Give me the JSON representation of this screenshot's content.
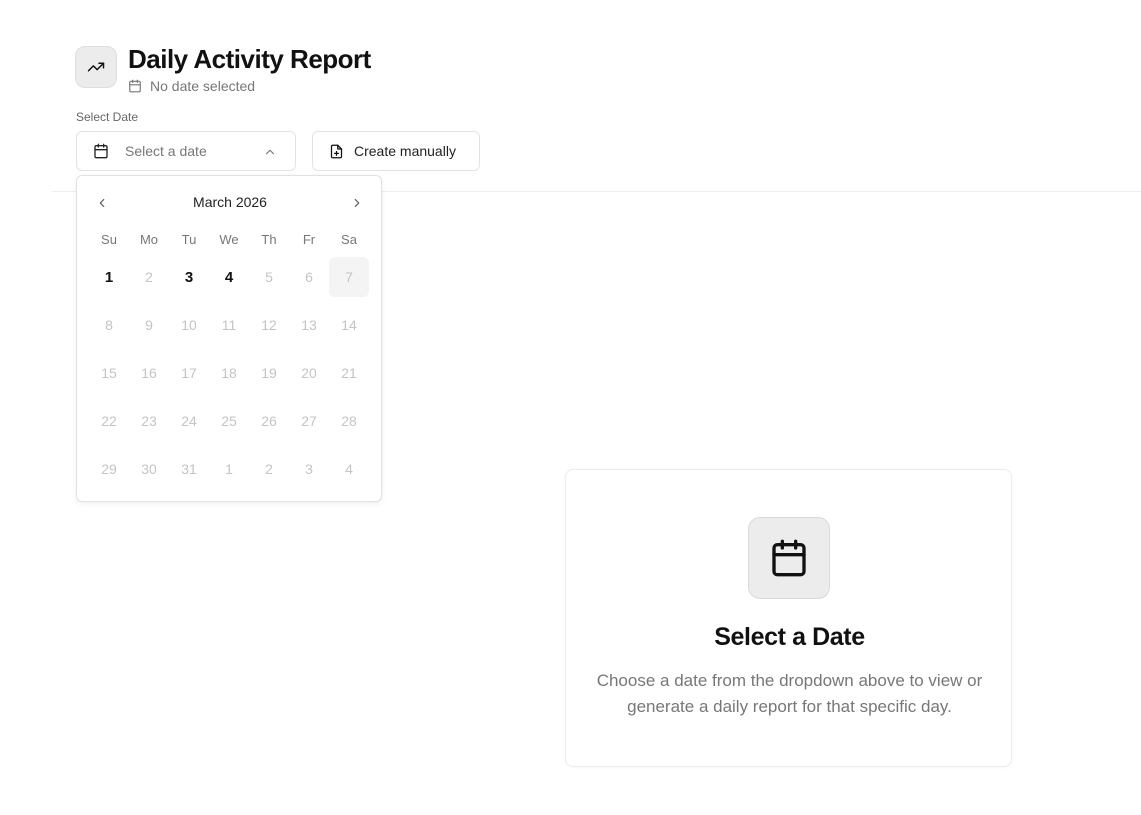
{
  "header": {
    "icon": "trending-up-icon",
    "title": "Daily Activity Report",
    "subtitle_icon": "calendar-icon",
    "subtitle": "No date selected"
  },
  "date_picker": {
    "label": "Select Date",
    "placeholder": "Select a date",
    "icon": "calendar-icon",
    "chevron_icon": "chevron-up-icon"
  },
  "manual_button": {
    "icon": "file-plus-icon",
    "label": "Create manually"
  },
  "calendar": {
    "month_label": "March 2026",
    "prev_icon": "chevron-left-icon",
    "next_icon": "chevron-right-icon",
    "weekdays": [
      "Su",
      "Mo",
      "Tu",
      "We",
      "Th",
      "Fr",
      "Sa"
    ],
    "days": [
      {
        "label": "1",
        "state": "available"
      },
      {
        "label": "2",
        "state": "disabled"
      },
      {
        "label": "3",
        "state": "available"
      },
      {
        "label": "4",
        "state": "available"
      },
      {
        "label": "5",
        "state": "disabled"
      },
      {
        "label": "6",
        "state": "disabled"
      },
      {
        "label": "7",
        "state": "today"
      },
      {
        "label": "8",
        "state": "disabled"
      },
      {
        "label": "9",
        "state": "disabled"
      },
      {
        "label": "10",
        "state": "disabled"
      },
      {
        "label": "11",
        "state": "disabled"
      },
      {
        "label": "12",
        "state": "disabled"
      },
      {
        "label": "13",
        "state": "disabled"
      },
      {
        "label": "14",
        "state": "disabled"
      },
      {
        "label": "15",
        "state": "disabled"
      },
      {
        "label": "16",
        "state": "disabled"
      },
      {
        "label": "17",
        "state": "disabled"
      },
      {
        "label": "18",
        "state": "disabled"
      },
      {
        "label": "19",
        "state": "disabled"
      },
      {
        "label": "20",
        "state": "disabled"
      },
      {
        "label": "21",
        "state": "disabled"
      },
      {
        "label": "22",
        "state": "disabled"
      },
      {
        "label": "23",
        "state": "disabled"
      },
      {
        "label": "24",
        "state": "disabled"
      },
      {
        "label": "25",
        "state": "disabled"
      },
      {
        "label": "26",
        "state": "disabled"
      },
      {
        "label": "27",
        "state": "disabled"
      },
      {
        "label": "28",
        "state": "disabled"
      },
      {
        "label": "29",
        "state": "disabled"
      },
      {
        "label": "30",
        "state": "disabled"
      },
      {
        "label": "31",
        "state": "disabled"
      },
      {
        "label": "1",
        "state": "disabled"
      },
      {
        "label": "2",
        "state": "disabled"
      },
      {
        "label": "3",
        "state": "disabled"
      },
      {
        "label": "4",
        "state": "disabled"
      }
    ]
  },
  "empty_state": {
    "icon": "calendar-icon",
    "title": "Select a Date",
    "description": "Choose a date from the dropdown above to view or generate a daily report for that specific day."
  }
}
